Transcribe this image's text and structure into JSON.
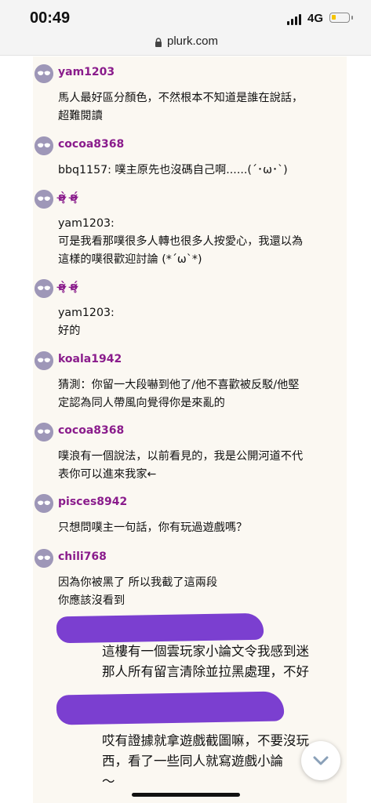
{
  "status": {
    "time": "00:49",
    "network": "4G"
  },
  "browser": {
    "url": "plurk.com"
  },
  "comments": [
    {
      "user": "yam1203",
      "text": "馬人最好區分顏色，不然根本不知道是誰在說話，\n超難閱讀"
    },
    {
      "user": "cocoa8368",
      "text": "bbq1157: 噗主原先也沒碼自己啊......(´･ω･`)"
    },
    {
      "user": "ʚ̴̶̷̥̀ ʚ̴̶̷̥́",
      "text": "yam1203:\n可是我看那噗很多人轉也很多人按愛心，我還以為\n這樣的噗很歡迎討論 (*´ω`*)"
    },
    {
      "user": "ʚ̴̶̷̥̀ ʚ̴̶̷̥́",
      "text": "yam1203:\n好的"
    },
    {
      "user": "koala1942",
      "text": "猜測：你留一大段嚇到他了/他不喜歡被反駁/他堅\n定認為同人帶風向覺得你是來亂的"
    },
    {
      "user": "cocoa8368",
      "text": "噗浪有一個說法，以前看見的，我是公開河道不代\n表你可以進來我家←"
    },
    {
      "user": "pisces8942",
      "text": "只想問噗主一句話，你有玩過遊戲嗎？"
    },
    {
      "user": "chili768",
      "text": "因為你被黑了 所以我截了這兩段\n你應該沒看到"
    }
  ],
  "quotes": [
    {
      "line1": "這樓有一個雲玩家小論文令我感到迷",
      "line2": "那人所有留言清除並拉黑處理，不好"
    },
    {
      "line1": "哎有證據就拿遊戲截圖嘛，不要沒玩",
      "line2": "西，看了一些同人就寫遊戲小論",
      "line3": "～"
    }
  ]
}
